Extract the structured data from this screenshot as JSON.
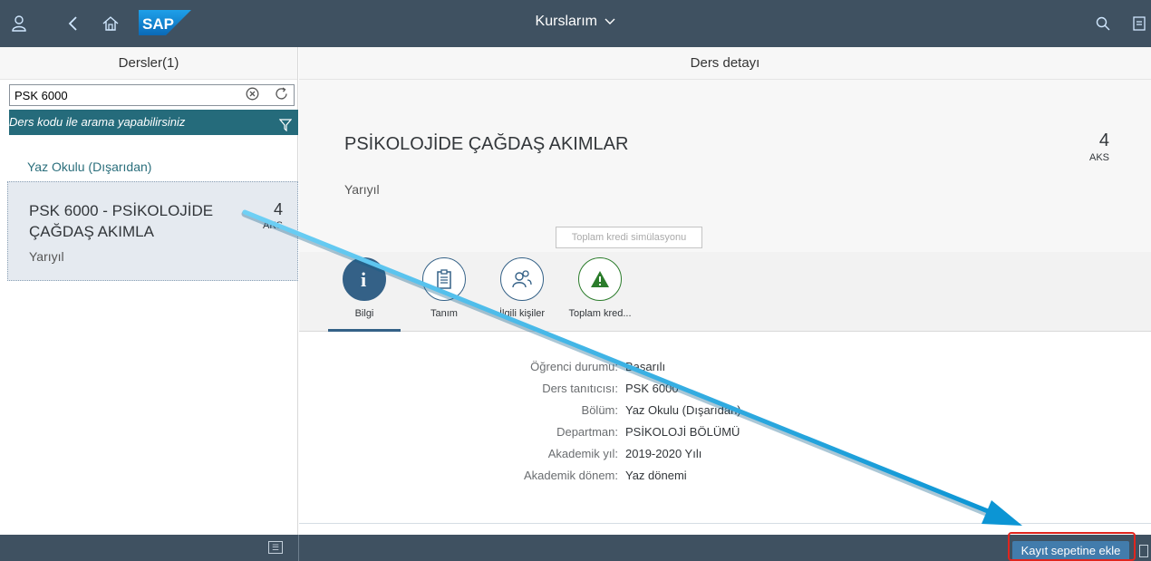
{
  "shell": {
    "title": "Kurslarım",
    "logo_text": "SAP",
    "icons": [
      "user-icon",
      "back-icon",
      "home-icon",
      "search-icon",
      "notifications-icon"
    ]
  },
  "master": {
    "header": "Dersler(1)",
    "search_value": "PSK 6000",
    "filter_info": "Ders kodu ile arama yapabilirsiniz",
    "group_header": "Yaz Okulu (Dışarıdan)",
    "items": [
      {
        "title": "PSK 6000 - PSİKOLOJİDE ÇAĞDAŞ AKIMLA",
        "number": "4",
        "unit": "AKS",
        "subtitle": "Yarıyıl"
      }
    ]
  },
  "detail": {
    "header": "Ders detayı",
    "title": "PSİKOLOJİDE ÇAĞDAŞ AKIMLAR",
    "number": "4",
    "unit": "AKS",
    "subtitle": "Yarıyıl",
    "tooltip": "Toplam kredi simülasyonu",
    "tabs": [
      {
        "label": "Bilgi",
        "icon": "info-icon"
      },
      {
        "label": "Tanım",
        "icon": "document-icon"
      },
      {
        "label": "İlgili kişiler",
        "icon": "people-icon"
      },
      {
        "label": "Toplam kred...",
        "icon": "warning-icon"
      }
    ],
    "fields": [
      {
        "label": "Öğrenci durumu:",
        "value": "Başarılı"
      },
      {
        "label": "Ders tanıtıcısı:",
        "value": "PSK 6000"
      },
      {
        "label": "Bölüm:",
        "value": "Yaz Okulu (Dışarıdan)"
      },
      {
        "label": "Departman:",
        "value": "PSİKOLOJİ BÖLÜMÜ"
      },
      {
        "label": "Akademik yıl:",
        "value": "2019-2020 Yılı"
      },
      {
        "label": "Akademik dönem:",
        "value": "Yaz dönemi"
      }
    ]
  },
  "footer": {
    "add_button": "Kayıt sepetine ekle"
  },
  "colors": {
    "shell": "#3f5161",
    "accent": "#346187",
    "filter_bar": "#256b7b",
    "button": "#427cac",
    "highlight": "#e0251e",
    "annotation_arrow": "#1aa6e0"
  }
}
